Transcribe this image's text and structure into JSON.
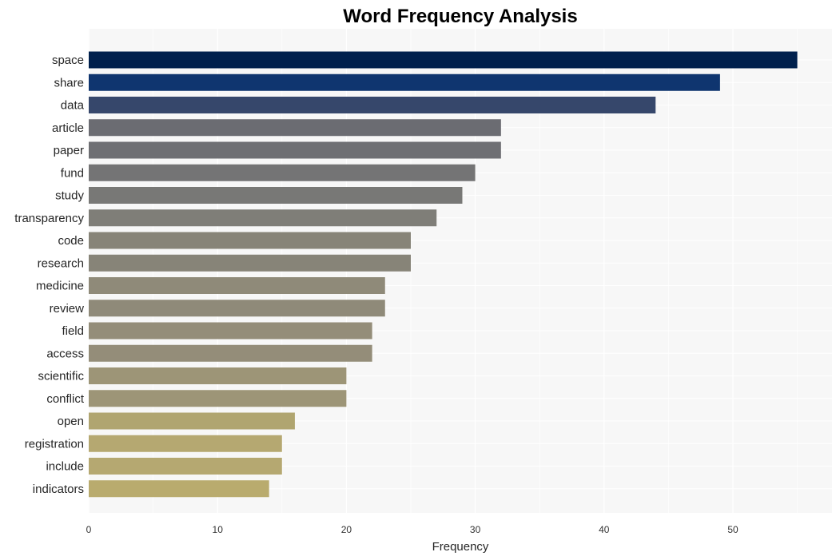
{
  "chart_data": {
    "type": "bar",
    "orientation": "horizontal",
    "title": "Word Frequency Analysis",
    "xlabel": "Frequency",
    "ylabel": "",
    "xlim": [
      0,
      57.6
    ],
    "xticks": [
      0,
      10,
      20,
      30,
      40,
      50
    ],
    "grid": true,
    "categories": [
      "space",
      "share",
      "data",
      "article",
      "paper",
      "fund",
      "study",
      "transparency",
      "code",
      "research",
      "medicine",
      "review",
      "field",
      "access",
      "scientific",
      "conflict",
      "open",
      "registration",
      "include",
      "indicators"
    ],
    "values": [
      55,
      49,
      44,
      32,
      32,
      30,
      29,
      27,
      25,
      25,
      23,
      23,
      22,
      22,
      20,
      20,
      16,
      15,
      15,
      14
    ],
    "colors": [
      "#00204d",
      "#0f356f",
      "#36476b",
      "#6b6c72",
      "#6e6f73",
      "#747475",
      "#787876",
      "#7f7e78",
      "#878478",
      "#878478",
      "#8f8a79",
      "#8f8a79",
      "#948d79",
      "#948d79",
      "#9d9577",
      "#9d9577",
      "#b0a570",
      "#b5a871",
      "#b5a871",
      "#b9ab6e"
    ]
  }
}
